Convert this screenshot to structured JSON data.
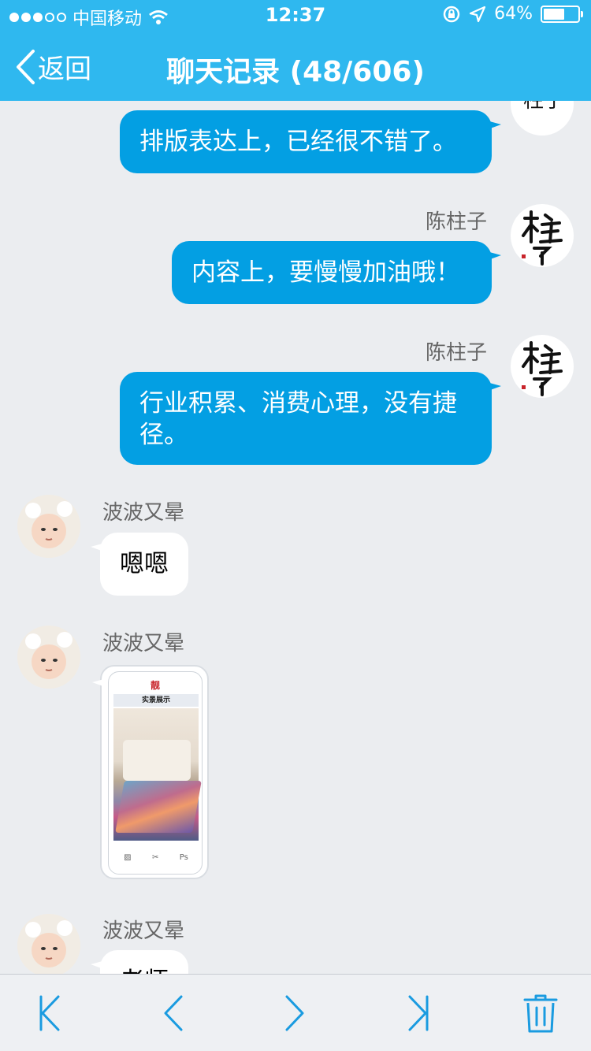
{
  "status_bar": {
    "carrier": "中国移动",
    "time": "12:37",
    "battery": "64%",
    "battery_level": 0.64
  },
  "nav": {
    "back_label": "返回",
    "title": "聊天记录 (48/606)"
  },
  "messages": [
    {
      "side": "right",
      "sender": "",
      "text": "排版表达上，已经很不错了。"
    },
    {
      "side": "right",
      "sender": "陈柱子",
      "text": "内容上，要慢慢加油哦！"
    },
    {
      "side": "right",
      "sender": "陈柱子",
      "text_line1": "行业积累、消费心理，没有捷",
      "text_line2": "径。"
    },
    {
      "side": "left",
      "sender": "波波又晕",
      "text": "嗯嗯"
    },
    {
      "side": "left",
      "sender": "波波又晕",
      "image": {
        "logo": "靓",
        "heading": "实景展示",
        "tools": [
          "▨",
          "✂",
          "Ps"
        ]
      }
    },
    {
      "side": "left",
      "sender": "波波又晕",
      "text": "老师"
    }
  ],
  "avatars": {
    "right_user_text": "柱子",
    "left_user_icon": "baby-avatar"
  },
  "toolbar": {
    "first_icon": "first-page-icon",
    "prev_icon": "previous-page-icon",
    "next_icon": "next-page-icon",
    "last_icon": "last-page-icon",
    "delete_icon": "trash-icon"
  },
  "colors": {
    "header": "#2fb8ef",
    "bubble_out": "#039fe3",
    "bubble_in": "#ffffff",
    "background": "#ebedf0",
    "toolbar_icon": "#1a9be0"
  }
}
